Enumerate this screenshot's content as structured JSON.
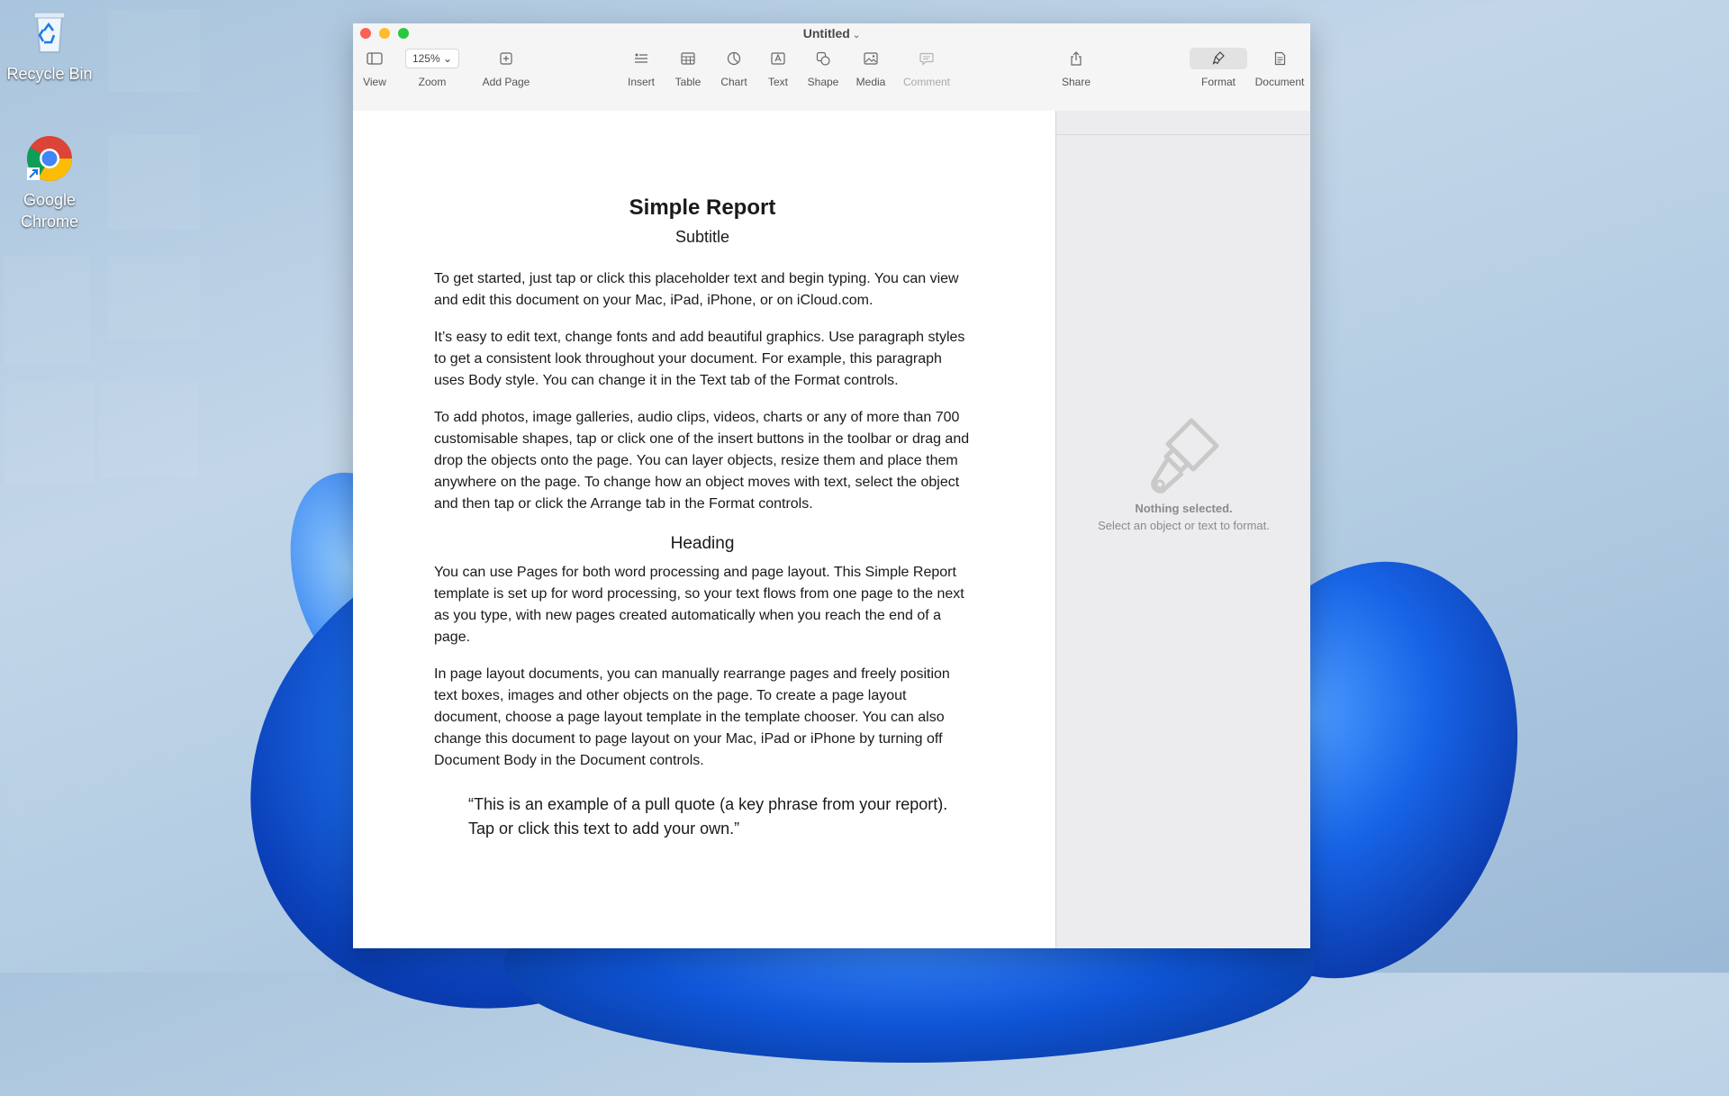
{
  "desktop": {
    "icons": [
      {
        "label": "Recycle Bin",
        "icon": "recycle-bin-icon"
      },
      {
        "label": "Google Chrome",
        "icon": "chrome-icon"
      }
    ]
  },
  "window": {
    "title": "Untitled",
    "toolbar": {
      "view": "View",
      "zoom_value": "125%",
      "zoom": "Zoom",
      "add_page": "Add Page",
      "insert": "Insert",
      "table": "Table",
      "chart": "Chart",
      "text": "Text",
      "shape": "Shape",
      "media": "Media",
      "comment": "Comment",
      "share": "Share",
      "format": "Format",
      "document": "Document"
    }
  },
  "document": {
    "title": "Simple Report",
    "subtitle": "Subtitle",
    "paragraphs": [
      "To get started, just tap or click this placeholder text and begin typing. You can view and edit this document on your Mac, iPad, iPhone, or on iCloud.com.",
      "It’s easy to edit text, change fonts and add beautiful graphics. Use paragraph styles to get a consistent look throughout your document. For example, this paragraph uses Body style. You can change it in the Text tab of the Format controls.",
      "To add photos, image galleries, audio clips, videos, charts or any of more than 700 customisable shapes, tap or click one of the insert buttons in the toolbar or drag and drop the objects onto the page. You can layer objects, resize them and place them anywhere on the page. To change how an object moves with text, select the object and then tap or click the Arrange tab in the Format controls."
    ],
    "heading": "Heading",
    "paragraphs2": [
      "You can use Pages for both word processing and page layout. This Simple Report template is set up for word processing, so your text flows from one page to the next as you type, with new pages created automatically when you reach the end of a page.",
      "In page layout documents, you can manually rearrange pages and freely position text boxes, images and other objects on the page. To create a page layout document, choose a page layout template in the template chooser. You can also change this document to page layout on your Mac, iPad or iPhone by turning off Document Body in the Document controls."
    ],
    "pull_quote": "“This is an example of a pull quote (a key phrase from your report). Tap or click this text to add your own.”"
  },
  "sidebar": {
    "empty_title": "Nothing selected.",
    "empty_hint": "Select an object or text to format.",
    "icon": "paintbrush-icon"
  }
}
